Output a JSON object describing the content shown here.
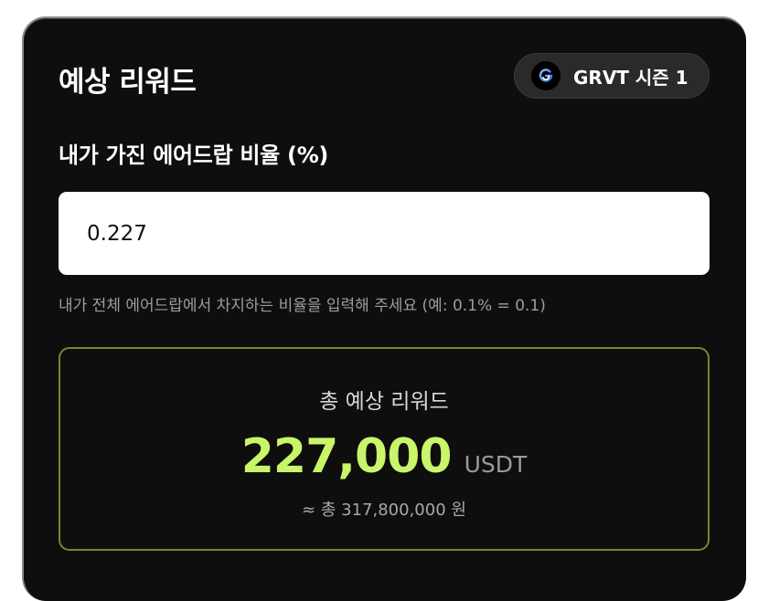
{
  "header": {
    "title": "예상 리워드",
    "season_label": "GRVT 시즌 1",
    "season_icon": "grvt-logo-icon"
  },
  "input": {
    "label": "내가 가진 에어드랍 비율 (%)",
    "value": "0.227",
    "helper": "내가 전체 에어드랍에서 차지하는 비율을 입력해 주세요 (예: 0.1% = 0.1)"
  },
  "result": {
    "title": "총 예상 리워드",
    "amount": "227,000",
    "unit": "USDT",
    "krw": "≈ 총 317,800,000 원"
  },
  "colors": {
    "background": "#0e0e0e",
    "accent": "#c9f56a",
    "result_border": "#6f8a30"
  }
}
